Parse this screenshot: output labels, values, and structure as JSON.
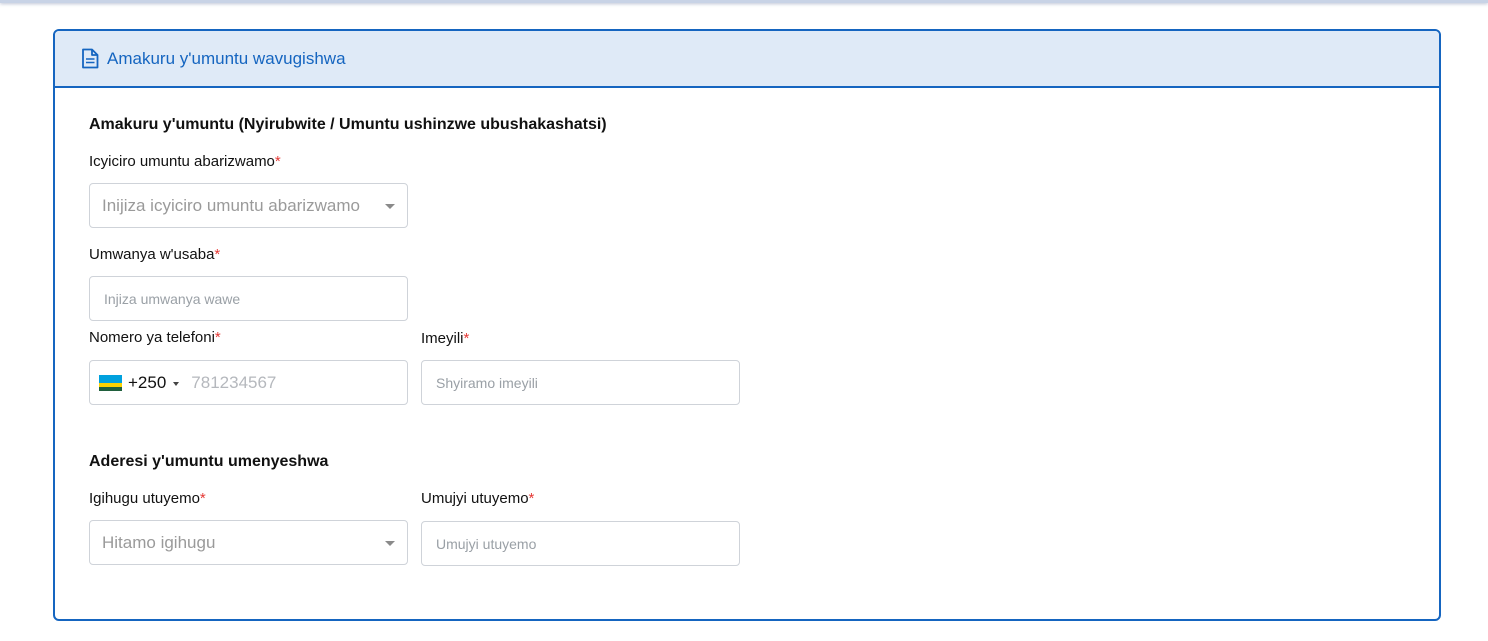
{
  "card": {
    "title": "Amakuru y'umuntu wavugishwa",
    "icon": "document-icon"
  },
  "personal": {
    "section_title": "Amakuru y'umuntu (Nyirubwite / Umuntu ushinzwe ubushakashatsi)",
    "institution": {
      "label": "Icyiciro umuntu abarizwamo",
      "placeholder": "Inijiza icyiciro umuntu abarizwamo"
    },
    "position": {
      "label": "Umwanya w'usaba",
      "placeholder": "Injiza umwanya wawe"
    },
    "phone": {
      "label": "Nomero ya telefoni",
      "country_code": "+250",
      "flag": "rwanda-flag-icon",
      "placeholder": "781234567"
    },
    "email": {
      "label": "Imeyili",
      "placeholder": "Shyiramo imeyili"
    }
  },
  "address": {
    "section_title": "Aderesi y'umuntu umenyeshwa",
    "country": {
      "label": "Igihugu utuyemo",
      "placeholder": "Hitamo igihugu"
    },
    "city": {
      "label": "Umujyi utuyemo",
      "placeholder": "Umujyi utuyemo"
    }
  },
  "required_marker": "*",
  "colors": {
    "accent": "#1565c0",
    "header_bg": "#dfeaf7",
    "required": "#e53935"
  }
}
